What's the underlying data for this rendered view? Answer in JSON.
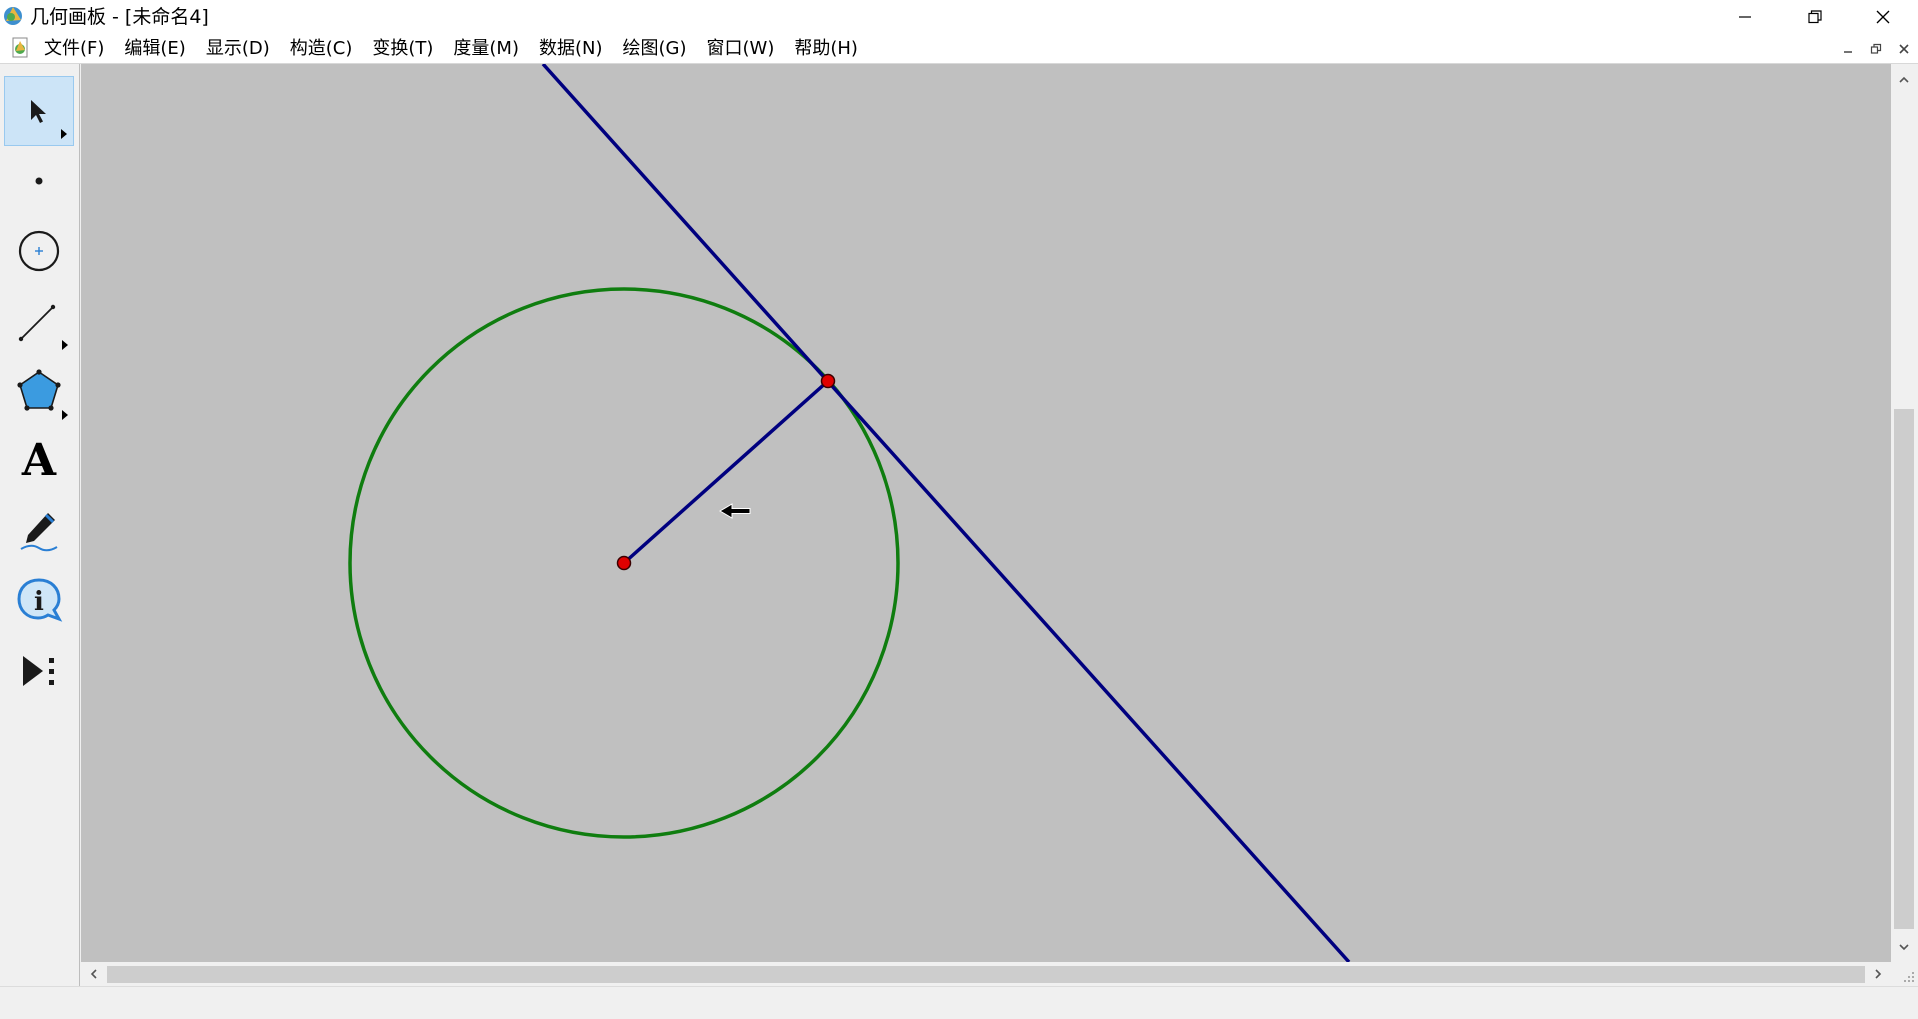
{
  "window": {
    "title": "几何画板 - [未命名4]"
  },
  "menu": {
    "items": [
      "文件(F)",
      "编辑(E)",
      "显示(D)",
      "构造(C)",
      "变换(T)",
      "度量(M)",
      "数据(N)",
      "绘图(G)",
      "窗口(W)",
      "帮助(H)"
    ]
  },
  "toolbox": {
    "tools": [
      {
        "name": "selection-arrow-tool",
        "icon": "arrow-icon",
        "selected": true
      },
      {
        "name": "point-tool",
        "icon": "point-icon"
      },
      {
        "name": "compass-tool",
        "icon": "circle-icon"
      },
      {
        "name": "straightedge-tool",
        "icon": "line-segment-icon"
      },
      {
        "name": "polygon-tool",
        "icon": "polygon-icon"
      },
      {
        "name": "text-tool",
        "icon": "text-a-icon",
        "label": "A"
      },
      {
        "name": "marker-tool",
        "icon": "marker-pen-icon"
      },
      {
        "name": "information-tool",
        "icon": "info-icon",
        "label": "i"
      },
      {
        "name": "custom-tool",
        "icon": "play-custom-icon"
      }
    ]
  },
  "sketch": {
    "background": "#c0c0c0",
    "circle_color": "#0f7d0f",
    "line_color": "#00007f",
    "point_color": "#e00000",
    "objects": [
      "circle",
      "radius-segment",
      "tangent-line",
      "center-point",
      "tangent-point"
    ]
  },
  "colors": {
    "canvas_bg": "#c0c0c0",
    "chrome_bg": "#f0f0f0",
    "selected_tool": "#cce4f7"
  }
}
